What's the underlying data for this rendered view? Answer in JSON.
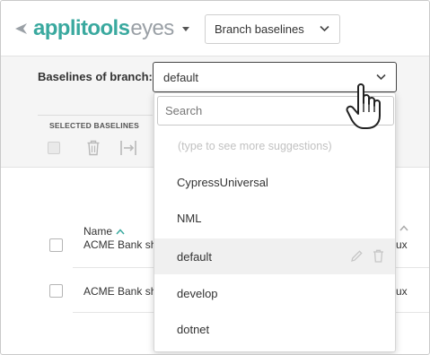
{
  "header": {
    "logo_primary": "applitools",
    "logo_secondary": "eyes",
    "branch_select_value": "Branch baselines"
  },
  "toolbar": {
    "baselines_label": "Baselines of branch:",
    "baselines_value": "default",
    "selected_title": "SELECTED BASELINES"
  },
  "table": {
    "name_header": "Name",
    "rows": [
      {
        "name": "ACME Bank sh",
        "tail": "ux"
      },
      {
        "name": "ACME Bank sh",
        "tail": "ux"
      }
    ]
  },
  "dropdown": {
    "search_placeholder": "Search",
    "hint": "(type to see more suggestions)",
    "items": [
      "CypressUniversal",
      "NML",
      "default",
      "develop",
      "dotnet"
    ],
    "hovered_item": "default"
  },
  "colors": {
    "brand": "#3aa99f",
    "brand_secondary": "#9aa0a6"
  }
}
